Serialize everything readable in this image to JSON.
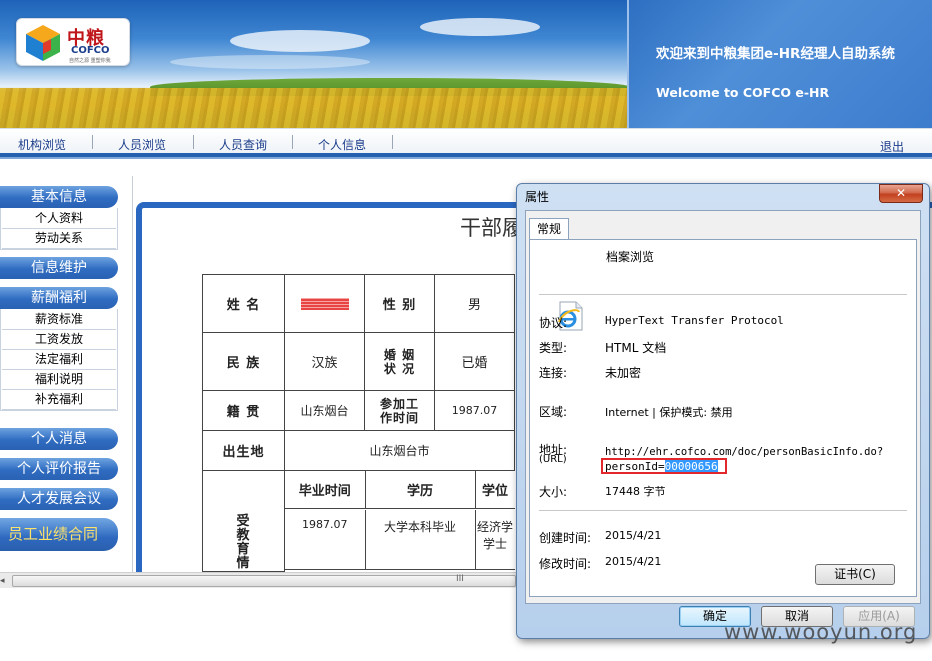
{
  "header": {
    "logo_cn": "中粮",
    "logo_en": "COFCO",
    "logo_tagline": "自然之源 重塑你我",
    "welcome_cn": "欢迎来到中粮集团e-HR经理人自助系统",
    "welcome_en": "Welcome to COFCO e-HR"
  },
  "nav": {
    "items": [
      "机构浏览",
      "人员浏览",
      "人员查询",
      "个人信息"
    ],
    "logout": "退出"
  },
  "sidebar": {
    "sections": [
      {
        "title": "基本信息",
        "items": [
          "个人资料",
          "劳动关系"
        ]
      },
      {
        "title": "信息维护",
        "items": []
      },
      {
        "title": "薪酬福利",
        "items": [
          "薪资标准",
          "工资发放",
          "法定福利",
          "福利说明",
          "补充福利"
        ]
      },
      {
        "title": "个人消息",
        "items": []
      },
      {
        "title": "个人评价报告",
        "items": []
      },
      {
        "title": "人才发展会议",
        "items": []
      }
    ],
    "featured": "员工业绩合同"
  },
  "document": {
    "title": "干部履",
    "labels": {
      "name": "姓 名",
      "gender": "性 别",
      "ethnicity": "民 族",
      "marriage": "婚 姻 状 况",
      "native_place": "籍 贯",
      "work_start": "参加工 作时间",
      "birthplace": "出生地",
      "education": "受 教 育 情",
      "grad_time": "毕业时间",
      "degree_edu": "学历",
      "degree": "学位"
    },
    "values": {
      "gender": "男",
      "ethnicity": "汉族",
      "marriage": "已婚",
      "native_place": "山东烟台",
      "work_start": "1987.07",
      "birthplace": "山东烟台市",
      "grad_time": "1987.07",
      "degree_edu": "大学本科毕业",
      "degree": "经济学学士"
    }
  },
  "dialog": {
    "title": "属性",
    "close": "✕",
    "tab": "常规",
    "file_name": "档案浏览",
    "props": {
      "protocol_label": "协议:",
      "protocol": "HyperText Transfer Protocol",
      "type_label": "类型:",
      "type": "HTML 文档",
      "connection_label": "连接:",
      "connection": "未加密",
      "zone_label": "区域:",
      "zone": "Internet | 保护模式: 禁用",
      "address_label": "地址:",
      "address_sub": "(URL)",
      "address_line1": "http://ehr.cofco.com/doc/personBasicInfo.do?",
      "address_param": "personId=",
      "address_id": "00000656",
      "size_label": "大小:",
      "size": "17448 字节",
      "created_label": "创建时间:",
      "created": "2015/4/21",
      "modified_label": "修改时间:",
      "modified": "2015/4/21"
    },
    "cert_button": "证书(C)",
    "ok": "确定",
    "cancel": "取消",
    "apply": "应用(A)"
  },
  "scroll_grip": "III",
  "watermark": "www.wooyun.org"
}
